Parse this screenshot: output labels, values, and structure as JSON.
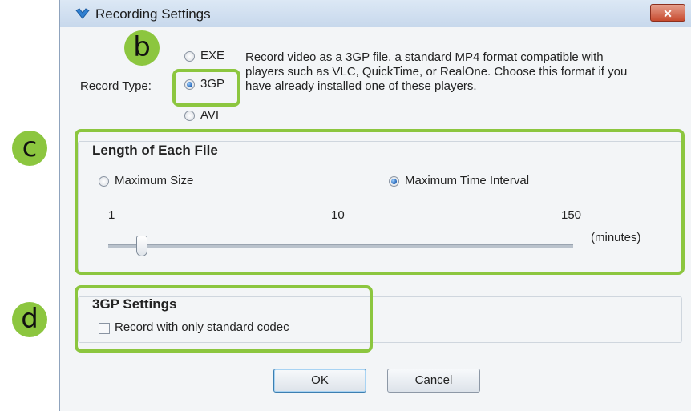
{
  "window": {
    "title": "Recording Settings",
    "close_glyph": "✕"
  },
  "record_type": {
    "label": "Record Type:",
    "options": [
      "EXE",
      "3GP",
      "AVI"
    ],
    "selected": "3GP",
    "description": "Record video as a 3GP file, a standard MP4 format compatible with players such as VLC, QuickTime, or RealOne. Choose this format if you have already installed one of these players."
  },
  "length_group": {
    "title": "Length of Each File",
    "option_size": "Maximum Size",
    "option_time": "Maximum Time Interval",
    "selected": "Maximum Time Interval",
    "scale_min": "1",
    "scale_mid": "10",
    "scale_max": "150",
    "unit": "(minutes)",
    "slider_value": 3
  },
  "gp_settings": {
    "title": "3GP Settings",
    "checkbox_label": "Record with only standard codec",
    "checked": false
  },
  "buttons": {
    "ok": "OK",
    "cancel": "Cancel"
  },
  "annotations": {
    "b": "b",
    "c": "c",
    "d": "d",
    "color": "#8cc63f"
  }
}
